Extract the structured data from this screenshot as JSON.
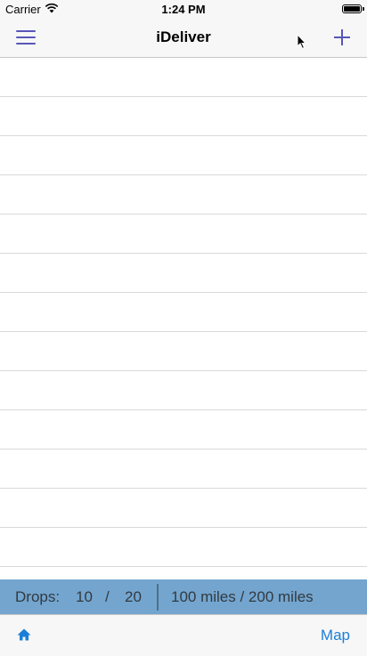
{
  "status_bar": {
    "carrier": "Carrier",
    "time": "1:24 PM",
    "battery_level": 1.0
  },
  "nav": {
    "title": "iDeliver",
    "left_icon": "hamburger-menu-icon",
    "right_icon": "plus-icon"
  },
  "table": {
    "row_count": 13
  },
  "summary": {
    "drops_label": "Drops:",
    "drops_completed": "10",
    "drops_separator": "/",
    "drops_total": "20",
    "miles": "100 miles / 200 miles"
  },
  "tab_bar": {
    "home_icon": "home-icon",
    "map_label": "Map"
  },
  "colors": {
    "accent": "#5856b8",
    "summary_bg": "#73a5cf",
    "link": "#1b7fd6"
  }
}
